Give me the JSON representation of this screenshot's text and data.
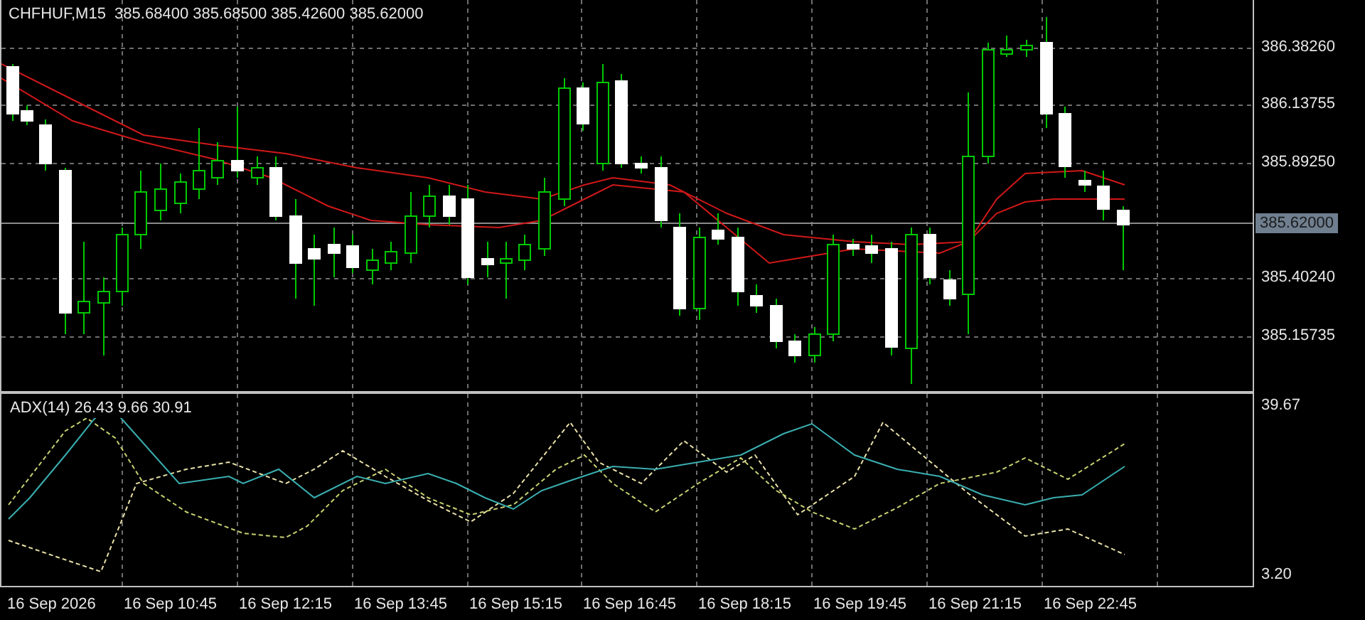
{
  "chart_header": {
    "text": "CHFHUF,M15  385.68400 385.68500 385.42600 385.62000"
  },
  "price_axis": {
    "labels": [
      "386.38260",
      "386.13755",
      "385.89250",
      "385.40240",
      "385.15735"
    ],
    "current_price": "385.62000"
  },
  "indicator": {
    "title": "ADX(14) 26.43 9.66 30.91",
    "axis_labels": [
      "39.67",
      "3.20"
    ]
  },
  "time_axis": {
    "labels": [
      "16 Sep 2026",
      "16 Sep 10:45",
      "16 Sep 12:15",
      "16 Sep 13:45",
      "16 Sep 15:15",
      "16 Sep 16:45",
      "16 Sep 18:15",
      "16 Sep 19:45",
      "16 Sep 21:15",
      "16 Sep 22:45"
    ]
  }
}
